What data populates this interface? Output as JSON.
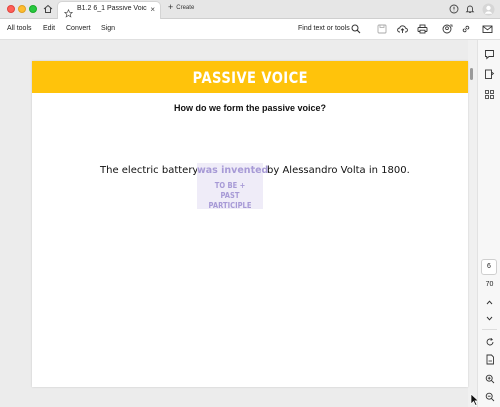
{
  "window": {
    "tab_title": "B1.2 6_1 Passive Voice_...",
    "tab_close": "×",
    "new_tab_label": "Create",
    "new_tab_plus": "+"
  },
  "toolbar": {
    "menu": [
      "All tools",
      "Edit",
      "Convert",
      "Sign"
    ],
    "find_label": "Find text or tools"
  },
  "document": {
    "banner_title": "PASSIVE VOICE",
    "question": "How do we form the passive voice?",
    "sentence_before": "The electric battery",
    "verb_phrase": "was invented",
    "verb_note_line1": "TO BE +",
    "verb_note_line2": "PAST PARTICIPLE",
    "sentence_after": "by Alessandro Volta in 1800.",
    "colors": {
      "banner": "#ffc30b",
      "highlight_bg": "#efecf8",
      "highlight_text": "#a79ad6"
    }
  },
  "navigation": {
    "current_page": "6",
    "total_pages": "70"
  }
}
